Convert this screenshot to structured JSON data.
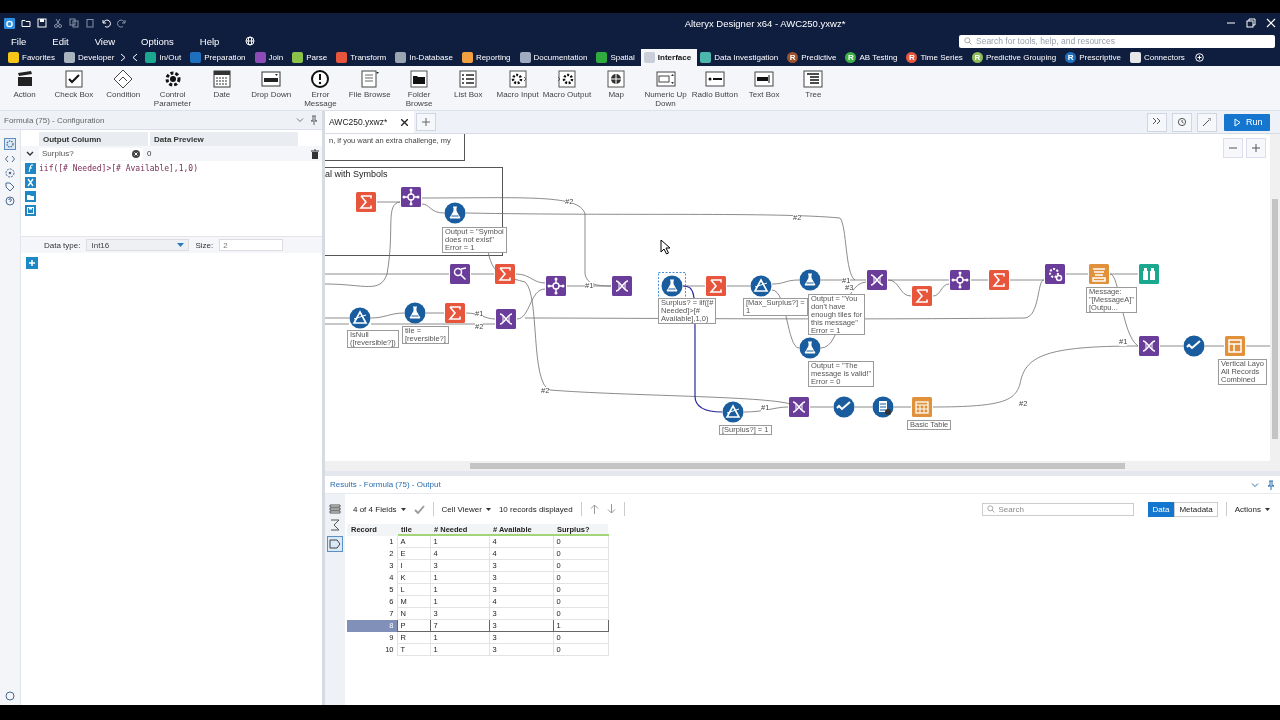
{
  "window": {
    "title": "Alteryx Designer x64 - AWC250.yxwz*"
  },
  "menu": [
    "File",
    "Edit",
    "View",
    "Options",
    "Help"
  ],
  "search": {
    "placeholder": "Search for tools, help, and resources"
  },
  "categories": [
    {
      "label": "Favorites",
      "selected": false,
      "color": "#f5c518"
    },
    {
      "label": "Developer",
      "selected": false,
      "color": "#a9b3bd"
    },
    {
      "label": "In/Out",
      "selected": false,
      "color": "#1aa88f"
    },
    {
      "label": "Preparation",
      "selected": false,
      "color": "#1f6fbf"
    },
    {
      "label": "Join",
      "selected": false,
      "color": "#8e4bb5"
    },
    {
      "label": "Parse",
      "selected": false,
      "color": "#8bc34a"
    },
    {
      "label": "Transform",
      "selected": false,
      "color": "#e8553d"
    },
    {
      "label": "In-Database",
      "selected": false,
      "color": "#9aa5b1"
    },
    {
      "label": "Reporting",
      "selected": false,
      "color": "#f0a040"
    },
    {
      "label": "Documentation",
      "selected": false,
      "color": "#a0aac0"
    },
    {
      "label": "Spatial",
      "selected": false,
      "color": "#2eaa3f"
    },
    {
      "label": "Interface",
      "selected": true,
      "color": "#c9ced8"
    },
    {
      "label": "Data Investigation",
      "selected": false,
      "color": "#4db6ac"
    },
    {
      "label": "Predictive",
      "selected": false,
      "color": "#a0522d",
      "badge": "R"
    },
    {
      "label": "AB Testing",
      "selected": false,
      "color": "#3cb043",
      "badge": "R"
    },
    {
      "label": "Time Series",
      "selected": false,
      "color": "#e8553d",
      "badge": "R"
    },
    {
      "label": "Predictive Grouping",
      "selected": false,
      "color": "#8fbc5a",
      "badge": "R"
    },
    {
      "label": "Prescriptive",
      "selected": false,
      "color": "#1f6fbf",
      "badge": "R"
    },
    {
      "label": "Connectors",
      "selected": false,
      "color": "#e8e8e8"
    }
  ],
  "tools": [
    "Action",
    "Check Box",
    "Condition",
    "Control Parameter",
    "Date",
    "Drop Down",
    "Error Message",
    "File Browse",
    "Folder Browse",
    "List Box",
    "Macro Input",
    "Macro Output",
    "Map",
    "Numeric Up Down",
    "Radio Button",
    "Text Box",
    "Tree"
  ],
  "config": {
    "title": "Formula (75) - Configuration",
    "headers": [
      "Output Column",
      "Data Preview"
    ],
    "output_column": "Surplus?",
    "preview": "0",
    "expression": "iif([# Needed]>[# Available],1,0)",
    "data_type_label": "Data type:",
    "data_type": "Int16",
    "size_label": "Size:",
    "size": "2"
  },
  "workflow": {
    "tab": "AWC250.yxwz*",
    "run": "Run"
  },
  "canvas": {
    "comment": "n, if you want an extra challenge, my",
    "container": "al with Symbols",
    "nodes": [
      {
        "kind": "summarize",
        "selected": false
      },
      {
        "kind": "join",
        "selected": false
      },
      {
        "kind": "formula",
        "selected": false,
        "annotation": [
          "Output = \"Symbol",
          "does not exist\"",
          "Error = 1"
        ]
      },
      {
        "kind": "find",
        "selected": false
      },
      {
        "kind": "summarize",
        "selected": false
      },
      {
        "kind": "join",
        "selected": false
      },
      {
        "kind": "select",
        "selected": false
      },
      {
        "kind": "formula",
        "selected": true,
        "annotation": [
          "Surplus? = iif([#",
          "Needed]>[#",
          "Available],1,0)"
        ]
      },
      {
        "kind": "summarize",
        "selected": false
      },
      {
        "kind": "filter",
        "selected": false,
        "annotation": [
          "[Max_Surplus?] =",
          "1"
        ]
      },
      {
        "kind": "formula",
        "selected": false,
        "annotation": [
          "Output = \"You",
          "don't have",
          "enough tiles for",
          "this message\"",
          "Error = 1"
        ]
      },
      {
        "kind": "formula",
        "selected": false,
        "annotation": [
          "Output = \"The",
          "message is valid!\"",
          "Error = 0"
        ]
      },
      {
        "kind": "select",
        "selected": false
      },
      {
        "kind": "summarize",
        "selected": false
      },
      {
        "kind": "join",
        "selected": false
      },
      {
        "kind": "summarize",
        "selected": false
      },
      {
        "kind": "dynamic",
        "selected": false
      },
      {
        "kind": "report",
        "selected": false,
        "annotation": [
          "Message:",
          "\"[MessageA]\"",
          "[Outpu..."
        ]
      },
      {
        "kind": "browse",
        "selected": false
      },
      {
        "kind": "filter",
        "selected": false,
        "annotation": [
          "IsNull",
          "([reversible?])"
        ]
      },
      {
        "kind": "formula",
        "selected": false,
        "annotation": [
          "tile =",
          "[reversible?]"
        ]
      },
      {
        "kind": "summarize",
        "selected": false
      },
      {
        "kind": "select",
        "selected": false
      },
      {
        "kind": "filter",
        "selected": false,
        "annotation": [
          "[Surplus?] = 1"
        ]
      },
      {
        "kind": "select",
        "selected": false
      },
      {
        "kind": "check",
        "selected": false
      },
      {
        "kind": "add",
        "selected": false
      },
      {
        "kind": "table",
        "selected": false,
        "annotation": [
          "Basic Table"
        ]
      },
      {
        "kind": "select",
        "selected": false
      },
      {
        "kind": "check",
        "selected": false
      },
      {
        "kind": "layout",
        "selected": false,
        "annotation": [
          "Vertical Layo",
          "All Records",
          "Combined"
        ]
      }
    ],
    "wire_labels": [
      "#2",
      "#2",
      "#1",
      "#1",
      "#2",
      "#1",
      "#3",
      "#2",
      "#1",
      "#1",
      "#2"
    ]
  },
  "results": {
    "title": "Results - Formula (75) - Output",
    "fields": "4 of 4 Fields",
    "viewer": "Cell Viewer",
    "records": "10 records displayed",
    "search_placeholder": "Search",
    "tabs": [
      {
        "label": "Data",
        "selected": true
      },
      {
        "label": "Metadata",
        "selected": false
      }
    ],
    "actions": "Actions",
    "columns": [
      "Record",
      "tile",
      "# Needed",
      "# Available",
      "Surplus?"
    ],
    "rows": [
      {
        "cells": [
          "1",
          "A",
          "1",
          "4",
          "0"
        ],
        "selected": false
      },
      {
        "cells": [
          "2",
          "E",
          "4",
          "4",
          "0"
        ],
        "selected": false
      },
      {
        "cells": [
          "3",
          "I",
          "3",
          "3",
          "0"
        ],
        "selected": false
      },
      {
        "cells": [
          "4",
          "K",
          "1",
          "3",
          "0"
        ],
        "selected": false
      },
      {
        "cells": [
          "5",
          "L",
          "1",
          "3",
          "0"
        ],
        "selected": false
      },
      {
        "cells": [
          "6",
          "M",
          "1",
          "4",
          "0"
        ],
        "selected": false
      },
      {
        "cells": [
          "7",
          "N",
          "3",
          "3",
          "0"
        ],
        "selected": false
      },
      {
        "cells": [
          "8",
          "P",
          "7",
          "3",
          "1"
        ],
        "selected": true
      },
      {
        "cells": [
          "9",
          "R",
          "1",
          "3",
          "0"
        ],
        "selected": false
      },
      {
        "cells": [
          "10",
          "T",
          "1",
          "3",
          "0"
        ],
        "selected": false
      }
    ]
  }
}
